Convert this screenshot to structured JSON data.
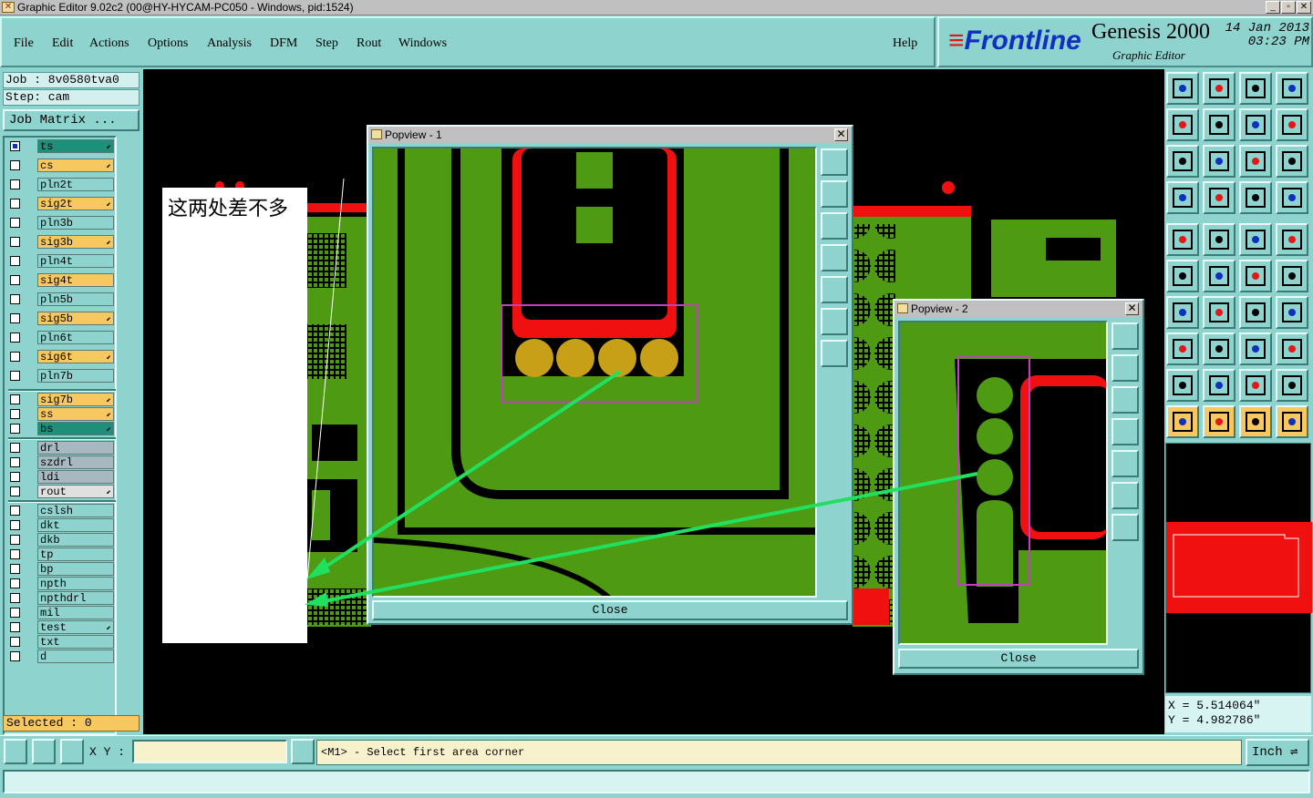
{
  "window": {
    "title": "Graphic Editor 9.02c2 (00@HY-HYCAM-PC050 - Windows, pid:1524)"
  },
  "menu": {
    "items": [
      "File",
      "Edit",
      "Actions",
      "Options",
      "Analysis",
      "DFM",
      "Step",
      "Rout",
      "Windows"
    ],
    "help": "Help"
  },
  "brand": {
    "logo": "Frontline",
    "product": "Genesis 2000",
    "subtitle": "Graphic Editor",
    "date": "14 Jan 2013",
    "time": "03:23 PM"
  },
  "job": {
    "job_label": "Job : 8v0580tva0",
    "step_label": "Step: cam",
    "matrix_button": "Job Matrix ..."
  },
  "layers": [
    {
      "name": "ts",
      "color": "#1f8f7a",
      "checked": true,
      "arrow": true
    },
    {
      "name": "cs",
      "color": "#f8c860",
      "checked": false,
      "arrow": true
    },
    {
      "name": "pln2t",
      "color": "#8fd3cf",
      "checked": false,
      "arrow": false
    },
    {
      "name": "sig2t",
      "color": "#f8c860",
      "checked": false,
      "arrow": true
    },
    {
      "name": "pln3b",
      "color": "#8fd3cf",
      "checked": false,
      "arrow": false
    },
    {
      "name": "sig3b",
      "color": "#f8c860",
      "checked": false,
      "arrow": true
    },
    {
      "name": "pln4t",
      "color": "#8fd3cf",
      "checked": false,
      "arrow": false
    },
    {
      "name": "sig4t",
      "color": "#f8c860",
      "checked": false,
      "arrow": false
    },
    {
      "name": "pln5b",
      "color": "#8fd3cf",
      "checked": false,
      "arrow": false
    },
    {
      "name": "sig5b",
      "color": "#f8c860",
      "checked": false,
      "arrow": true
    },
    {
      "name": "pln6t",
      "color": "#8fd3cf",
      "checked": false,
      "arrow": false
    },
    {
      "name": "sig6t",
      "color": "#f8c860",
      "checked": false,
      "arrow": true
    },
    {
      "name": "pln7b",
      "color": "#8fd3cf",
      "checked": false,
      "arrow": false
    },
    {
      "name": "sig7b",
      "color": "#f8c860",
      "checked": false,
      "arrow": true
    },
    {
      "name": "ss",
      "color": "#f8c860",
      "checked": false,
      "arrow": true
    },
    {
      "name": "bs",
      "color": "#1f8f7a",
      "checked": false,
      "arrow": true
    },
    {
      "name": "drl",
      "color": "#a8b8c0",
      "checked": false,
      "arrow": false
    },
    {
      "name": "szdrl",
      "color": "#a8b8c0",
      "checked": false,
      "arrow": false
    },
    {
      "name": "ldi",
      "color": "#a8b8c0",
      "checked": false,
      "arrow": false
    },
    {
      "name": "rout",
      "color": "#e0e0e0",
      "checked": false,
      "arrow": true
    },
    {
      "name": "cslsh",
      "color": "#8fd3cf",
      "checked": false,
      "arrow": false
    },
    {
      "name": "dkt",
      "color": "#8fd3cf",
      "checked": false,
      "arrow": false
    },
    {
      "name": "dkb",
      "color": "#8fd3cf",
      "checked": false,
      "arrow": false
    },
    {
      "name": "tp",
      "color": "#8fd3cf",
      "checked": false,
      "arrow": false
    },
    {
      "name": "bp",
      "color": "#8fd3cf",
      "checked": false,
      "arrow": false
    },
    {
      "name": "npth",
      "color": "#8fd3cf",
      "checked": false,
      "arrow": false
    },
    {
      "name": "npthdrl",
      "color": "#8fd3cf",
      "checked": false,
      "arrow": false
    },
    {
      "name": "mil",
      "color": "#8fd3cf",
      "checked": false,
      "arrow": false
    },
    {
      "name": "test",
      "color": "#8fd3cf",
      "checked": false,
      "arrow": true
    },
    {
      "name": "txt",
      "color": "#8fd3cf",
      "checked": false,
      "arrow": false
    },
    {
      "name": "d",
      "color": "#8fd3cf",
      "checked": false,
      "arrow": false
    }
  ],
  "selected_label": "Selected : 0",
  "note_text": "这两处差不多",
  "popview1": {
    "title": "Popview - 1",
    "close_label": "Close"
  },
  "popview2": {
    "title": "Popview - 2",
    "close_label": "Close"
  },
  "coords": {
    "x": "X = 5.514064\"",
    "y": "Y = 4.982786\""
  },
  "bottom": {
    "xy_label": "X Y :",
    "xy_value": "",
    "message": "<M1> - Select first area corner",
    "units": "Inch"
  },
  "colors": {
    "pcb_green": "#4e9a12",
    "pcb_red": "#f01010",
    "pad_gold": "#c8a018",
    "highlight_magenta": "#c040c0",
    "arrow_green": "#20e060",
    "panel_teal": "#8fd3cf"
  }
}
